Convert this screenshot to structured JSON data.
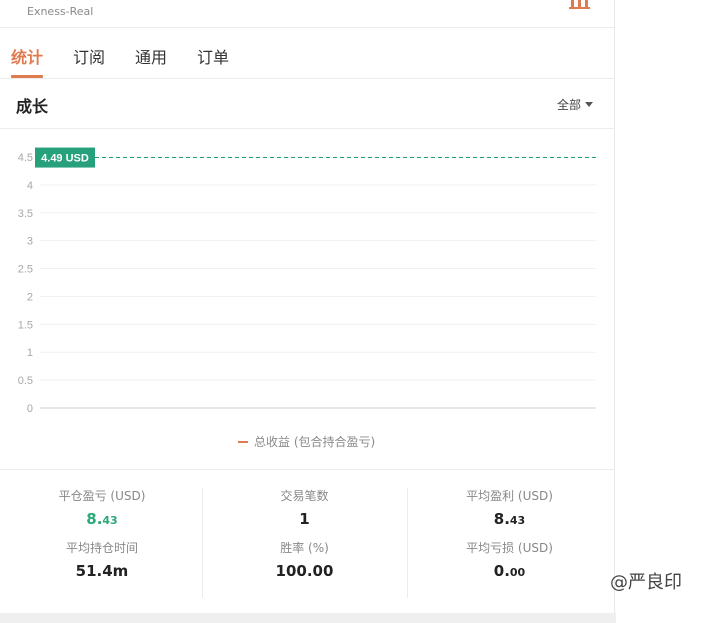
{
  "header": {
    "account": "Exness-Real"
  },
  "tabs": [
    {
      "label": "统计",
      "active": true
    },
    {
      "label": "订阅"
    },
    {
      "label": "通用"
    },
    {
      "label": "订单"
    }
  ],
  "section": {
    "title": "成长",
    "range": "全部"
  },
  "chart_data": {
    "type": "line",
    "x": [],
    "series": [
      {
        "name": "总收益 (包合持合盈亏)",
        "values": []
      }
    ],
    "ylim": [
      0,
      4.5
    ],
    "yticks": [
      "0",
      "0.5",
      "1",
      "1.5",
      "2",
      "2.5",
      "3",
      "3.5",
      "4",
      "4.5"
    ],
    "marker_value": 4.49,
    "marker_label": "4.49 USD",
    "grid": true,
    "legend": "bottom-center",
    "colors": {
      "line": "#e07b4f",
      "marker": "#26a17b"
    }
  },
  "stats": {
    "closed_pnl": {
      "label": "平仓盈亏 (USD)",
      "int": "8.",
      "dec": "43"
    },
    "trades": {
      "label": "交易笔数",
      "value": "1"
    },
    "avg_profit": {
      "label": "平均盈利 (USD)",
      "int": "8.",
      "dec": "43"
    },
    "avg_hold": {
      "label": "平均持仓时间",
      "value": "51.4m"
    },
    "win_rate": {
      "label": "胜率 (%)",
      "value": "100.00"
    },
    "avg_loss": {
      "label": "平均亏损 (USD)",
      "int": "0.",
      "dec": "00"
    }
  },
  "watermark": "@严良印"
}
